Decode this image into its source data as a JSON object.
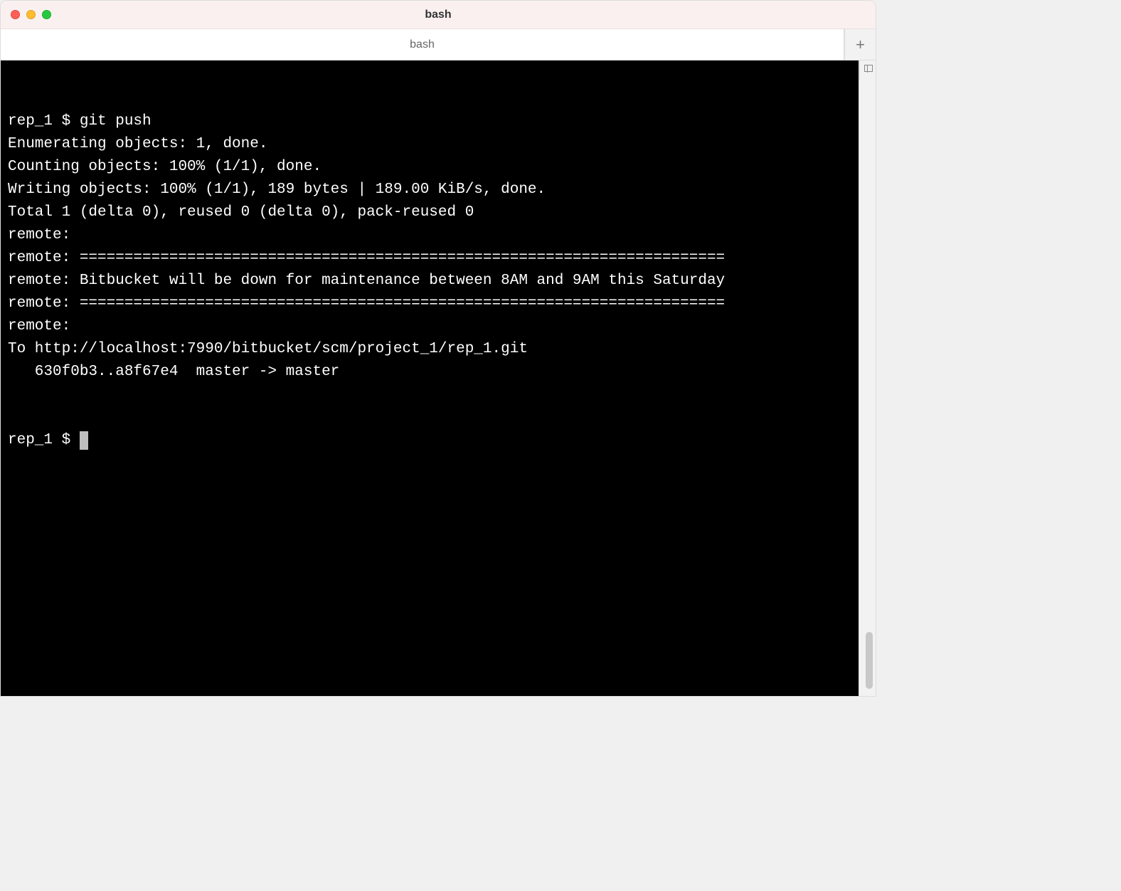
{
  "window": {
    "title": "bash"
  },
  "tabbar": {
    "tabs": [
      {
        "label": "bash"
      }
    ],
    "add_label": "+"
  },
  "terminal": {
    "lines": [
      "rep_1 $ git push",
      "Enumerating objects: 1, done.",
      "Counting objects: 100% (1/1), done.",
      "Writing objects: 100% (1/1), 189 bytes | 189.00 KiB/s, done.",
      "Total 1 (delta 0), reused 0 (delta 0), pack-reused 0",
      "remote:",
      "remote: ========================================================================",
      "remote: Bitbucket will be down for maintenance between 8AM and 9AM this Saturday",
      "remote: ========================================================================",
      "remote:",
      "To http://localhost:7990/bitbucket/scm/project_1/rep_1.git",
      "   630f0b3..a8f67e4  master -> master"
    ],
    "prompt": "rep_1 $ "
  }
}
